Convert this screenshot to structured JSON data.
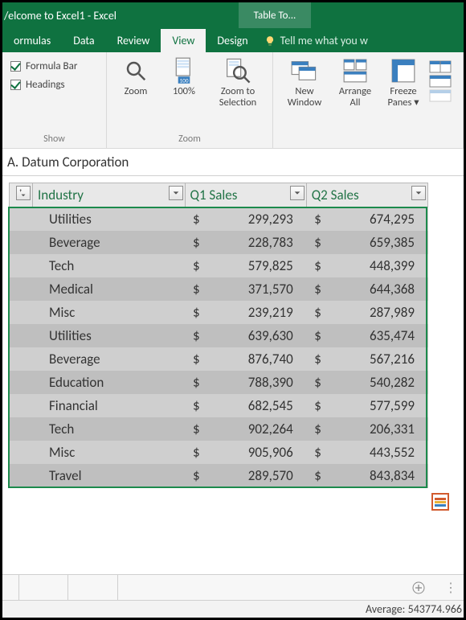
{
  "titlebar": {
    "window_title": "/elcome to Excel1 - Excel",
    "table_tools": "Table To..."
  },
  "ribbon": {
    "tabs": [
      "ormulas",
      "Data",
      "Review",
      "View",
      "Design"
    ],
    "tellme": "Tell me what you w",
    "show": {
      "formula_bar": "Formula Bar",
      "headings": "Headings",
      "group_label": "Show"
    },
    "zoom": {
      "zoom": "Zoom",
      "hundred": "100%",
      "to_selection": "Zoom to Selection",
      "group_label": "Zoom"
    },
    "window": {
      "new_window": "New Window",
      "arrange_all": "Arrange All",
      "freeze_panes": "Freeze Panes ▾"
    }
  },
  "formula_bar": {
    "content": "A. Datum Corporation"
  },
  "table": {
    "headers": [
      "Industry",
      "Q1 Sales",
      "Q2 Sales"
    ],
    "currency": "$",
    "rows": [
      {
        "industry": "Utilities",
        "q1": "299,293",
        "q2": "674,295"
      },
      {
        "industry": "Beverage",
        "q1": "228,783",
        "q2": "659,385"
      },
      {
        "industry": "Tech",
        "q1": "579,825",
        "q2": "448,399"
      },
      {
        "industry": "Medical",
        "q1": "371,570",
        "q2": "644,368"
      },
      {
        "industry": "Misc",
        "q1": "239,219",
        "q2": "287,989"
      },
      {
        "industry": "Utilities",
        "q1": "639,630",
        "q2": "635,474"
      },
      {
        "industry": "Beverage",
        "q1": "876,740",
        "q2": "567,216"
      },
      {
        "industry": "Education",
        "q1": "788,390",
        "q2": "540,282"
      },
      {
        "industry": "Financial",
        "q1": "682,545",
        "q2": "577,599"
      },
      {
        "industry": "Tech",
        "q1": "902,264",
        "q2": "206,331"
      },
      {
        "industry": "Misc",
        "q1": "905,906",
        "q2": "443,552"
      },
      {
        "industry": "Travel",
        "q1": "289,570",
        "q2": "843,834"
      }
    ]
  },
  "status": {
    "average": "Average: 543774.966"
  }
}
